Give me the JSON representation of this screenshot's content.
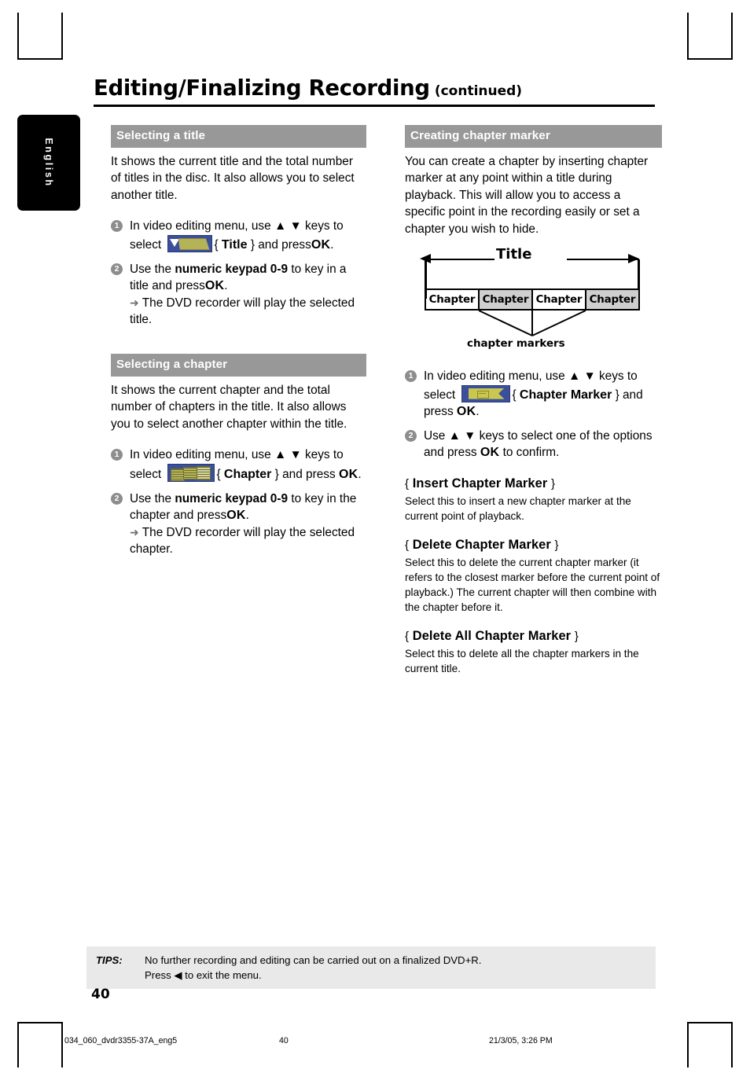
{
  "language_tab": "English",
  "header": {
    "title": "Editing/Finalizing Recording",
    "continued": "(continued)"
  },
  "left_column": {
    "section1": {
      "heading": "Selecting a title",
      "intro": "It shows the current title and the total number of titles in the disc.  It also allows you to select another title.",
      "steps": [
        {
          "num": "1",
          "pre": "In video editing menu, use ▲ ▼ keys to select",
          "icon": "title-menu-icon",
          "post_brace_open": "{",
          "keyword": "Title",
          "post_brace_close": "} and press",
          "ok": "OK",
          "period": "."
        },
        {
          "num": "2",
          "pre": "Use the",
          "keyword": "numeric keypad 0-9",
          "mid": "to key in a title and press",
          "ok": "OK",
          "period": ".",
          "result": "The DVD recorder will play the selected title."
        }
      ]
    },
    "section2": {
      "heading": "Selecting a chapter",
      "intro": "It shows the current chapter and the total number of chapters in the title. It also allows you to select another chapter within the title.",
      "steps": [
        {
          "num": "1",
          "pre": "In video editing menu, use ▲ ▼ keys to select",
          "icon": "chapter-menu-icon",
          "post_brace_open": "{",
          "keyword": "Chapter",
          "post_brace_close": "} and press",
          "ok": "OK",
          "period": "."
        },
        {
          "num": "2",
          "pre": "Use the",
          "keyword": "numeric keypad 0-9",
          "mid": "to key in the chapter and press",
          "ok": "OK",
          "period": ".",
          "result": "The DVD recorder will play the selected chapter."
        }
      ]
    }
  },
  "right_column": {
    "section": {
      "heading": "Creating chapter marker",
      "intro": "You can create a chapter by inserting chapter marker at any point within a title during playback.  This will allow you to access a specific point in the recording easily or set a chapter you wish to hide."
    },
    "diagram": {
      "title_label": "Title",
      "chapters": [
        "Chapter",
        "Chapter",
        "Chapter",
        "Chapter"
      ],
      "caption": "chapter markers"
    },
    "steps": [
      {
        "num": "1",
        "pre": "In video editing menu, use ▲ ▼ keys to select",
        "icon": "chapter-marker-menu-icon",
        "post_brace_open": "{",
        "keyword": "Chapter Marker",
        "post_brace_close": "} and press",
        "ok": "OK",
        "period": "."
      },
      {
        "num": "2",
        "pre": "Use ▲ ▼ keys to select one of the options and press",
        "ok": "OK",
        "post": "to confirm."
      }
    ],
    "options": [
      {
        "brace_open": "{",
        "title": "Insert Chapter Marker",
        "brace_close": "}",
        "body": "Select this to insert a new chapter marker at the current point of playback."
      },
      {
        "brace_open": "{",
        "title": "Delete Chapter Marker",
        "brace_close": "}",
        "body": "Select this to delete the current chapter marker (it refers to the closest marker before the current point of playback.)  The current chapter will then combine with the chapter before it."
      },
      {
        "brace_open": "{",
        "title": "Delete All Chapter Marker",
        "brace_close": "}",
        "body": "Select this to delete all the chapter markers in the current title."
      }
    ]
  },
  "tips": {
    "label": "TIPS:",
    "line1": "No further recording and editing can be carried out on a finalized DVD+R.",
    "line2": "Press ◀ to exit the menu."
  },
  "page_number": "40",
  "print_footer": {
    "file": "034_060_dvdr3355-37A_eng5",
    "page": "40",
    "date": "21/3/05, 3:26 PM"
  },
  "colors": {
    "section_heading_bg": "#989898",
    "step_bullet_bg": "#8d8d8d",
    "tips_bg": "#e9e9e9",
    "icon_bg": "#3b4f9b",
    "icon_fg": "#b5b357",
    "diagram_shaded": "#cfcfcf"
  }
}
